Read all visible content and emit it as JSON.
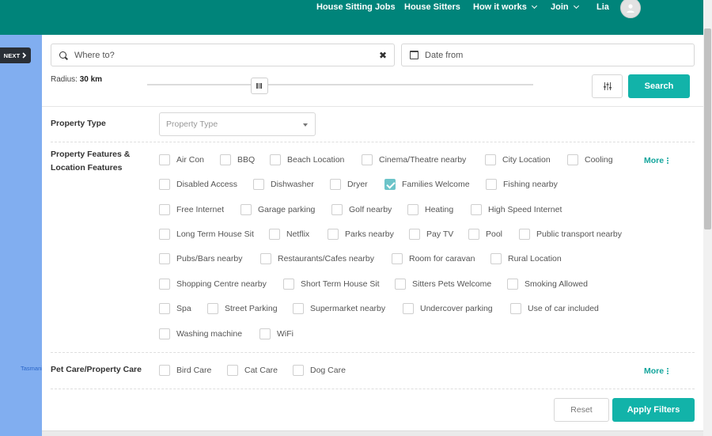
{
  "nav": {
    "items": [
      {
        "label": "House Sitting Jobs",
        "dropdown": false
      },
      {
        "label": "House Sitters",
        "dropdown": false
      },
      {
        "label": "How it works",
        "dropdown": true
      },
      {
        "label": "Join",
        "dropdown": true
      },
      {
        "label": "Lia",
        "dropdown": false
      }
    ]
  },
  "sidebar": {
    "next_label": "NEXT",
    "side_text": "Tasmania"
  },
  "search": {
    "placeholder": "Where to?",
    "date_placeholder": "Date from"
  },
  "radius": {
    "label": "Radius:",
    "value": "30 km",
    "slider_fraction": 0.29
  },
  "buttons": {
    "search": "Search",
    "reset": "Reset",
    "apply": "Apply Filters",
    "more": "More"
  },
  "property_type": {
    "label": "Property Type",
    "placeholder": "Property Type"
  },
  "features": {
    "label_line1": "Property Features &",
    "label_line2": "Location Features",
    "items": [
      {
        "label": "Air Con",
        "checked": false
      },
      {
        "label": "BBQ",
        "checked": false
      },
      {
        "label": "Beach Location",
        "checked": false
      },
      {
        "label": "Cinema/Theatre nearby",
        "checked": false
      },
      {
        "label": "City Location",
        "checked": false
      },
      {
        "label": "Cooling",
        "checked": false
      },
      {
        "label": "Disabled Access",
        "checked": false
      },
      {
        "label": "Dishwasher",
        "checked": false
      },
      {
        "label": "Dryer",
        "checked": false
      },
      {
        "label": "Families Welcome",
        "checked": true
      },
      {
        "label": "Fishing nearby",
        "checked": false
      },
      {
        "label": "Free Internet",
        "checked": false
      },
      {
        "label": "Garage parking",
        "checked": false
      },
      {
        "label": "Golf nearby",
        "checked": false
      },
      {
        "label": "Heating",
        "checked": false
      },
      {
        "label": "High Speed Internet",
        "checked": false
      },
      {
        "label": "Long Term House Sit",
        "checked": false
      },
      {
        "label": "Netflix",
        "checked": false
      },
      {
        "label": "Parks nearby",
        "checked": false
      },
      {
        "label": "Pay TV",
        "checked": false
      },
      {
        "label": "Pool",
        "checked": false
      },
      {
        "label": "Public transport nearby",
        "checked": false
      },
      {
        "label": "Pubs/Bars nearby",
        "checked": false
      },
      {
        "label": "Restaurants/Cafes nearby",
        "checked": false
      },
      {
        "label": "Room for caravan",
        "checked": false
      },
      {
        "label": "Rural Location",
        "checked": false
      },
      {
        "label": "Shopping Centre nearby",
        "checked": false
      },
      {
        "label": "Short Term House Sit",
        "checked": false
      },
      {
        "label": "Sitters Pets Welcome",
        "checked": false
      },
      {
        "label": "Smoking Allowed",
        "checked": false
      },
      {
        "label": "Spa",
        "checked": false
      },
      {
        "label": "Street Parking",
        "checked": false
      },
      {
        "label": "Supermarket nearby",
        "checked": false
      },
      {
        "label": "Undercover parking",
        "checked": false
      },
      {
        "label": "Use of car included",
        "checked": false
      },
      {
        "label": "Washing machine",
        "checked": false
      },
      {
        "label": "WiFi",
        "checked": false
      }
    ]
  },
  "pet_care": {
    "label": "Pet Care/Property Care",
    "items": [
      {
        "label": "Bird Care",
        "checked": false
      },
      {
        "label": "Cat Care",
        "checked": false
      },
      {
        "label": "Dog Care",
        "checked": false
      }
    ]
  },
  "colors": {
    "header": "#00847a",
    "accent": "#12b3a9",
    "checked": "#6cc4c9",
    "left_column": "#81aef0"
  }
}
